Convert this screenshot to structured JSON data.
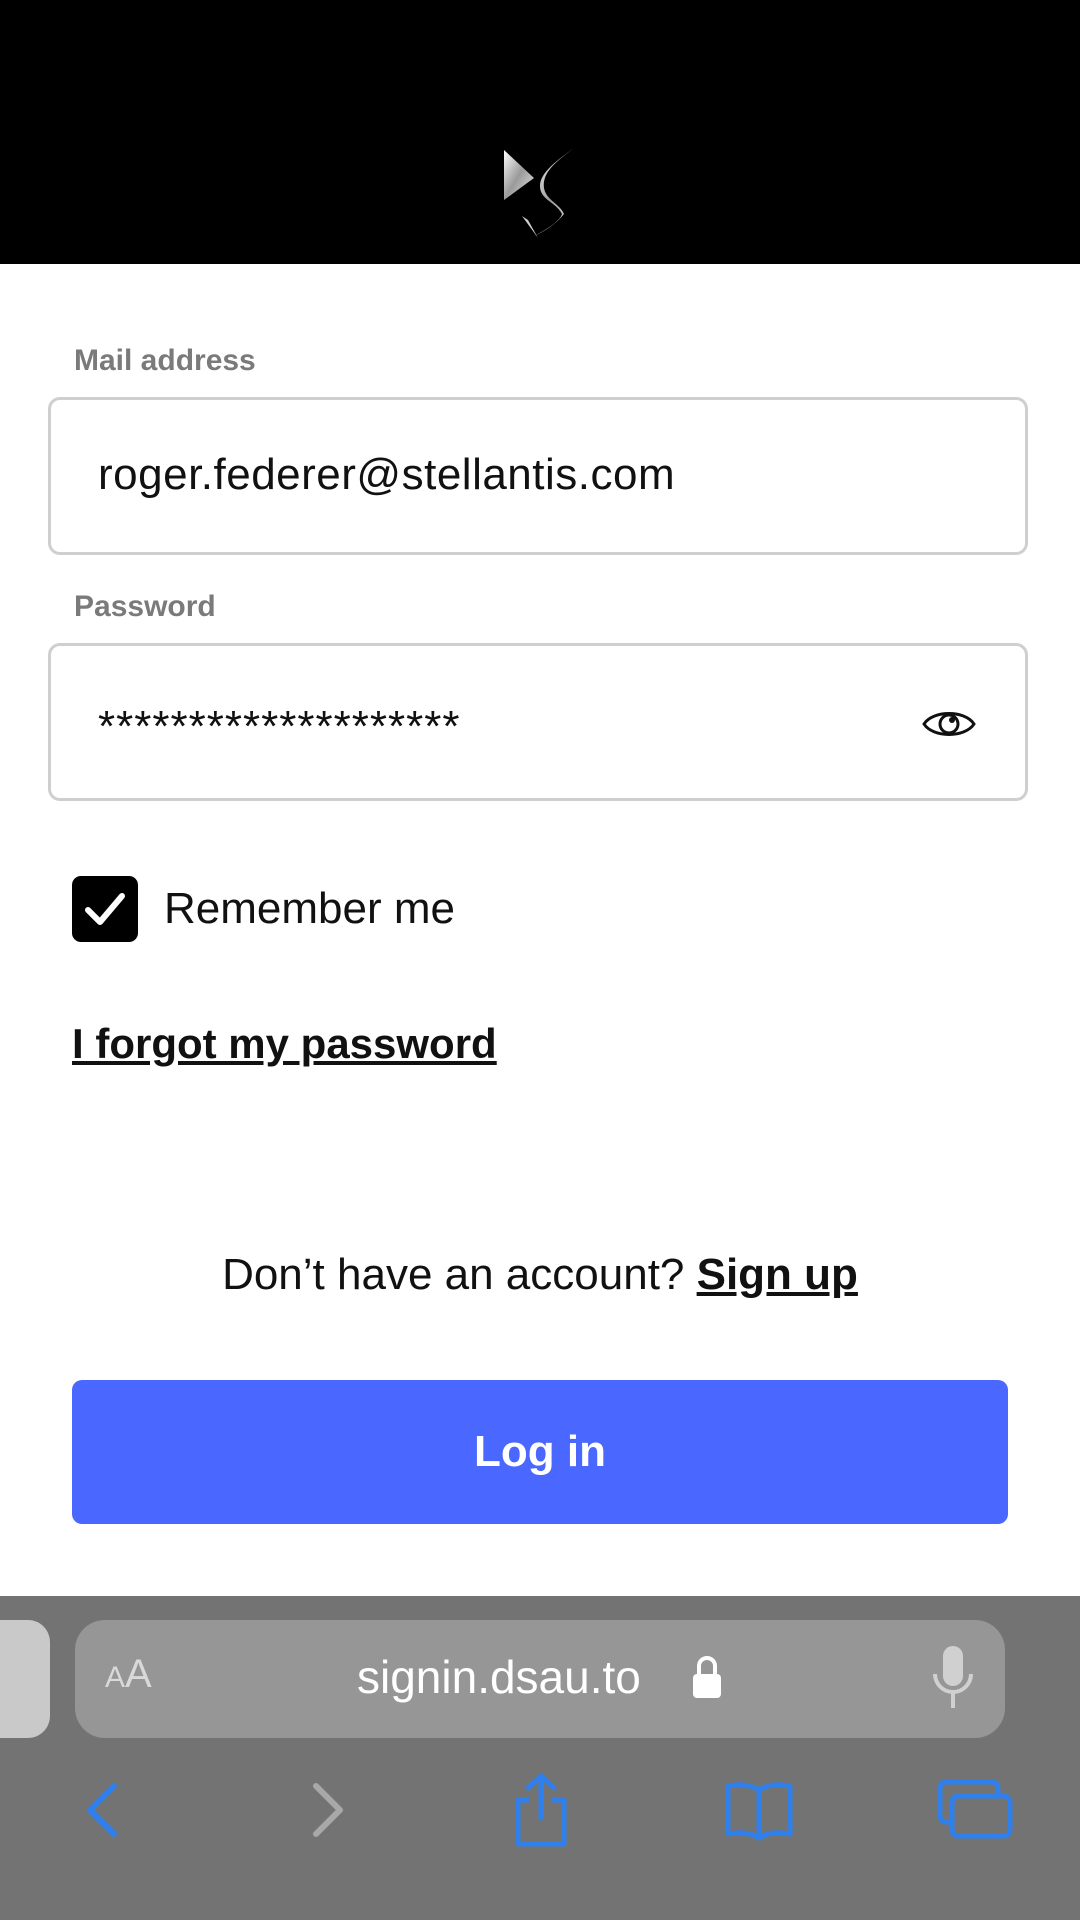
{
  "header": {
    "logo": "ds-logo"
  },
  "form": {
    "email_label": "Mail address",
    "email_value": "roger.federer@stellantis.com",
    "password_label": "Password",
    "password_value": "********************",
    "show_password_icon": "eye-icon",
    "remember_label": "Remember me",
    "remember_checked": true,
    "forgot_link": "I forgot my password",
    "signup_prompt": "Don’t have an account? ",
    "signup_link": "Sign up",
    "login_button": "Log in",
    "login_button_color": "#4a67ff"
  },
  "browser": {
    "text_size_label_small": "A",
    "text_size_label_large": "A",
    "url": "signin.dsau.to",
    "nav_accent_color": "#2f80ed",
    "nav": [
      "back-icon",
      "forward-icon",
      "share-icon",
      "bookmarks-icon",
      "tabs-icon"
    ]
  }
}
